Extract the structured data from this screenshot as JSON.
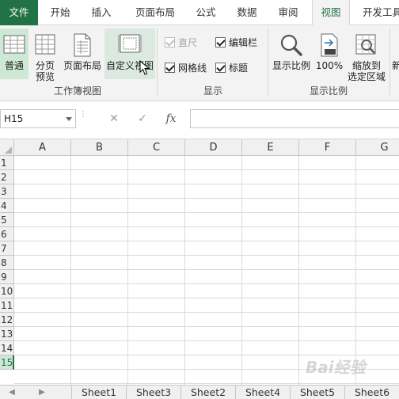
{
  "tabs": [
    "文件",
    "开始",
    "插入",
    "页面布局",
    "公式",
    "数据",
    "审阅",
    "视图",
    "开发工具"
  ],
  "active_tab": "视图",
  "ribbon": {
    "workbook_views": {
      "normal": "普通",
      "page_break_line1": "分页",
      "page_break_line2": "预览",
      "page_layout": "页面布局",
      "custom_views": "自定义视图",
      "group_label": "工作簿视图"
    },
    "show": {
      "ruler": "直尺",
      "formula_bar": "编辑栏",
      "gridlines": "网格线",
      "headings": "标题",
      "group_label": "显示"
    },
    "zoom": {
      "zoom": "显示比例",
      "zoom_100": "100%",
      "zoom_sel_line1": "缩放到",
      "zoom_sel_line2": "选定区域",
      "group_label": "显示比例"
    },
    "extra": "新"
  },
  "formula_bar": {
    "name_box": "H15",
    "cancel": "✕",
    "enter": "✓",
    "fx": "fx",
    "content": ""
  },
  "columns": [
    "A",
    "B",
    "C",
    "D",
    "E",
    "F",
    "G"
  ],
  "rows": [
    "1",
    "2",
    "3",
    "4",
    "5",
    "6",
    "7",
    "8",
    "9",
    "10",
    "11",
    "12",
    "13",
    "14",
    "15"
  ],
  "selected_row": "15",
  "sheets": [
    "Sheet1",
    "Sheet3",
    "Sheet2",
    "Sheet4",
    "Sheet5",
    "Sheet6"
  ],
  "watermark": "Bai经验",
  "colors": {
    "accent": "#217346"
  }
}
